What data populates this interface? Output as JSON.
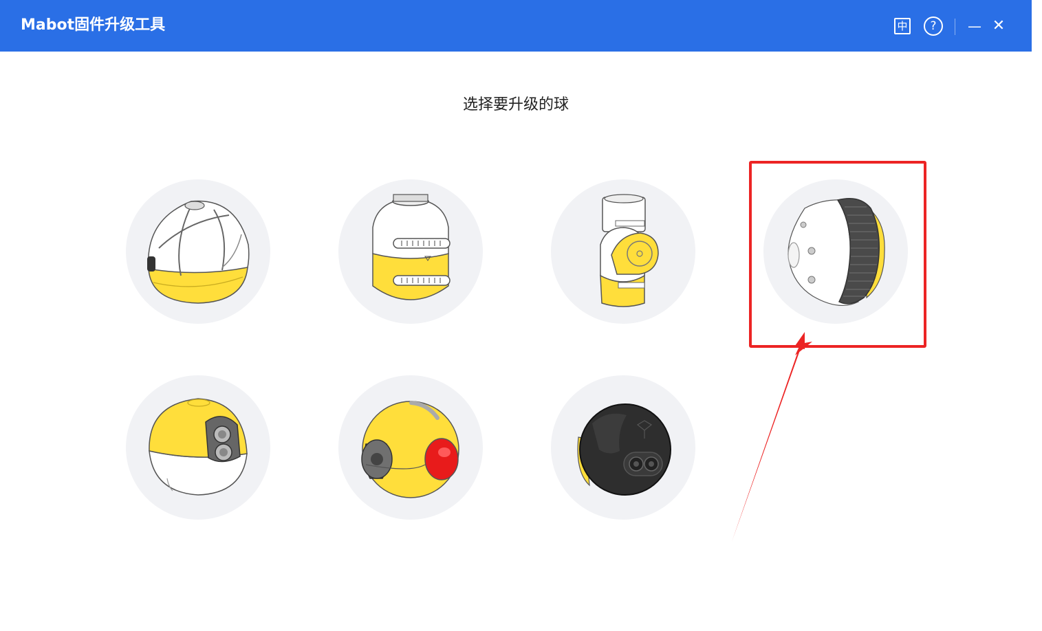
{
  "window": {
    "title": "Mabot固件升级工具",
    "language_label": "中",
    "help_label": "?",
    "minimize_label": "—",
    "close_label": "✕"
  },
  "main": {
    "heading": "选择要升级的球",
    "balls": [
      {
        "name": "controller-ball-icon"
      },
      {
        "name": "drive-ball-icon"
      },
      {
        "name": "servo-ball-icon"
      },
      {
        "name": "wheel-ball-icon",
        "selected": true
      },
      {
        "name": "distance-sensor-ball-icon"
      },
      {
        "name": "color-sensor-ball-icon"
      },
      {
        "name": "black-sensor-ball-icon"
      }
    ]
  },
  "colors": {
    "titlebar": "#2a6fe6",
    "card_bg": "#f1f2f5",
    "ball_yellow": "#ffde3b",
    "annotation_red": "#ec2424"
  }
}
